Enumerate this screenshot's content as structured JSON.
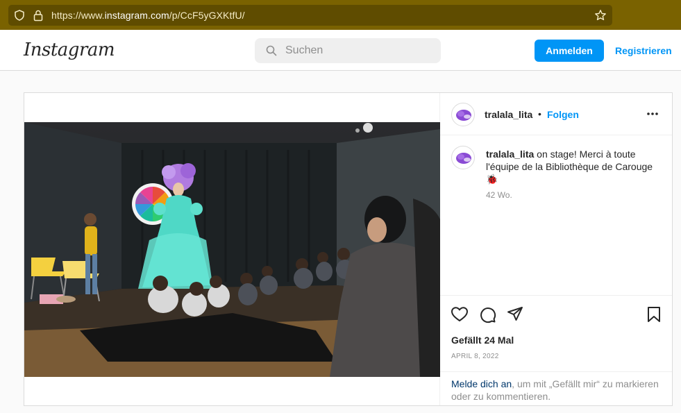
{
  "browser": {
    "url_prefix": "https://www.",
    "url_domain": "instagram.com",
    "url_path": "/p/CcF5yGXKtfU/"
  },
  "header": {
    "logo": "Instagram",
    "search_placeholder": "Suchen",
    "login_label": "Anmelden",
    "register_label": "Registrieren"
  },
  "post": {
    "username": "tralala_lita",
    "separator": "•",
    "follow_label": "Folgen",
    "caption_user": "tralala_lita",
    "caption_text": " on stage! Merci à toute l'équipe de la Bibliothèque de Carouge 🐞",
    "caption_time": "42 Wo.",
    "likes": "Gefällt 24 Mal",
    "date": "APRIL 8, 2022",
    "login_link": "Melde dich an",
    "login_rest": ", um mit „Gefällt mir“ zu markieren oder zu kommentieren."
  },
  "icons": [
    "shield-icon",
    "lock-icon",
    "star-icon",
    "search-icon",
    "more-icon",
    "heart-icon",
    "comment-icon",
    "share-icon",
    "bookmark-icon"
  ],
  "colors": {
    "accent": "#0095f6",
    "browser_bar": "#7a6200",
    "link_dark": "#00376b"
  }
}
